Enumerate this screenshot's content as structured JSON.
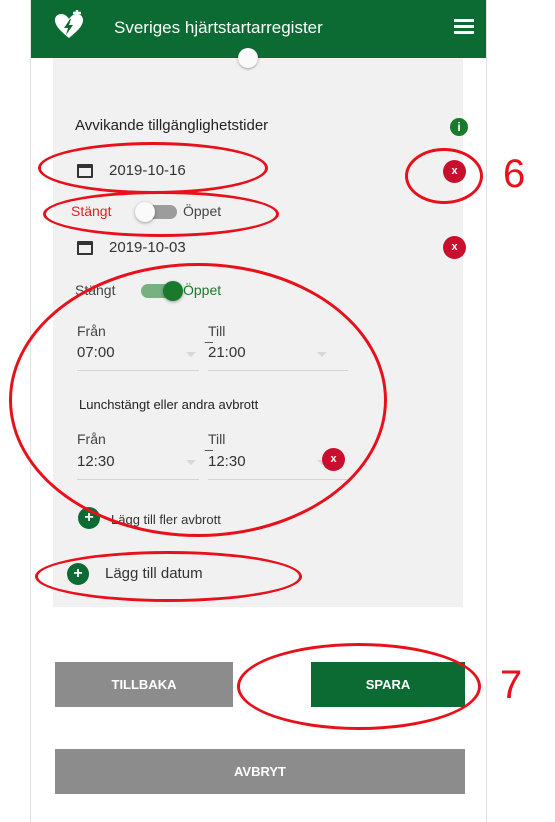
{
  "header": {
    "title": "Sveriges hjärtstartarregister",
    "logo_icon": "heart-defibrillator-logo-icon",
    "menu_icon": "hamburger-menu-icon"
  },
  "section": {
    "title": "Avvikande tillgänglighetstider",
    "info_icon": "info-icon",
    "info_glyph": "i"
  },
  "dates": [
    {
      "date": "2019-10-16",
      "closed_label": "Stängt",
      "open_label": "Öppet",
      "is_open": false,
      "delete_glyph": "x"
    },
    {
      "date": "2019-10-03",
      "closed_label": "Stängt",
      "open_label": "Öppet",
      "is_open": true,
      "delete_glyph": "x",
      "hours": {
        "from_label": "Från",
        "from_value": "07:00",
        "to_label": "Till",
        "to_value": "21:00"
      },
      "break_title": "Lunchstängt eller andra avbrott",
      "break": {
        "from_label": "Från",
        "from_value": "12:30",
        "to_label": "Till",
        "to_value": "12:30"
      },
      "add_break_label": "Lägg till fler avbrott"
    }
  ],
  "dash": "_",
  "add_date_label": "Lägg till datum",
  "add_glyph": "+",
  "buttons": {
    "back": "TILLBAKA",
    "save": "SPARA",
    "cancel": "AVBRYT"
  },
  "annotations": {
    "six": "6",
    "seven": "7"
  },
  "colors": {
    "brand_green": "#0b6b32",
    "delete_red": "#c8102e",
    "annotation_red": "#e8101a",
    "button_gray": "#8c8c8c",
    "closed_red": "#e02020",
    "open_green": "#1a7a2c"
  }
}
